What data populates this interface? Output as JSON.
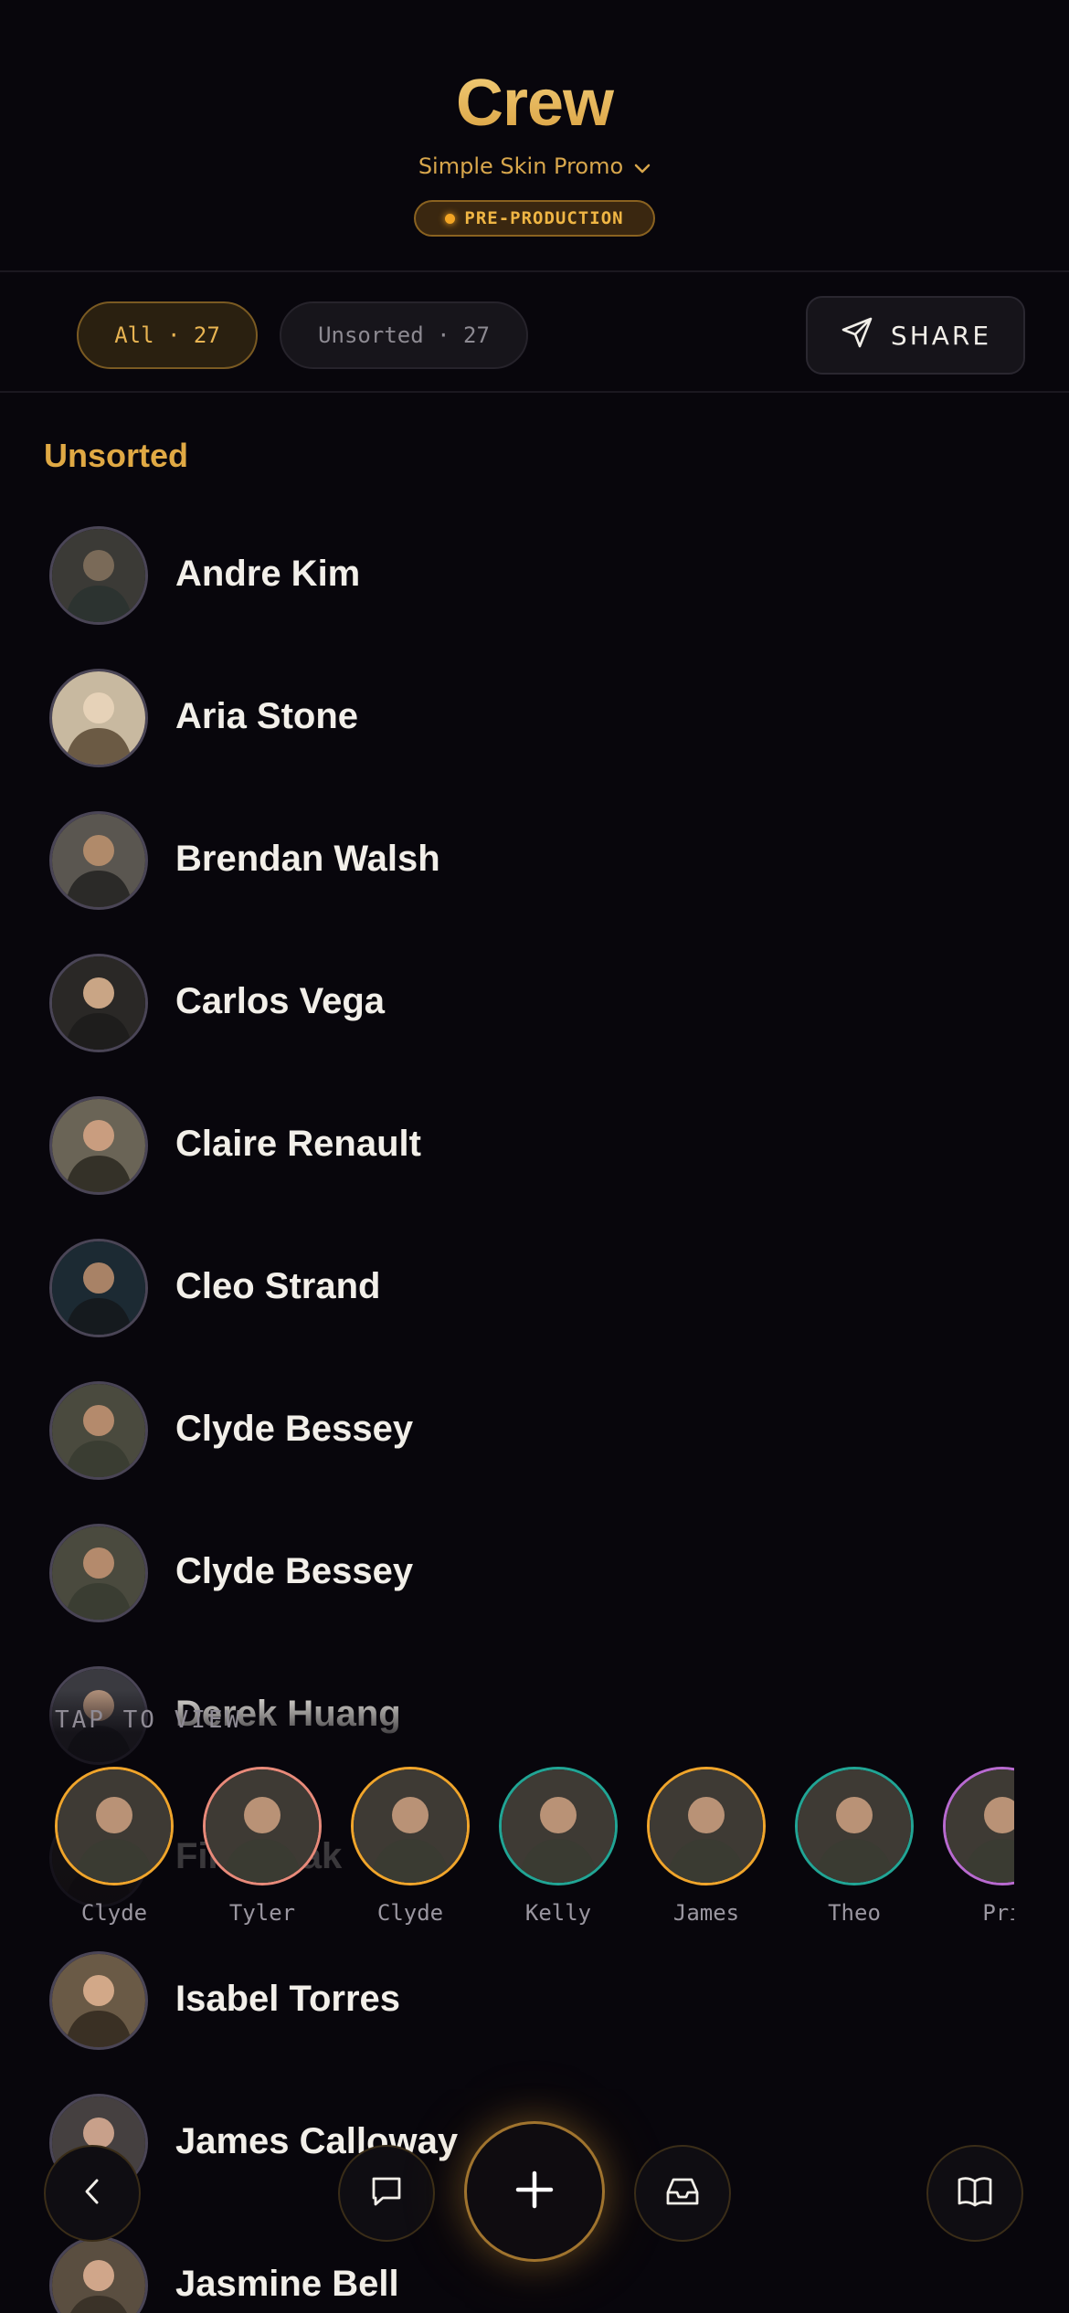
{
  "header": {
    "title": "Crew",
    "project": "Simple Skin Promo",
    "status": "PRE-PRODUCTION"
  },
  "filters": {
    "all_label": "All · 27",
    "unsorted_label": "Unsorted · 27",
    "share_label": "SHARE"
  },
  "section": {
    "label": "Unsorted"
  },
  "crew": [
    {
      "name": "Andre Kim"
    },
    {
      "name": "Aria Stone"
    },
    {
      "name": "Brendan Walsh"
    },
    {
      "name": "Carlos Vega"
    },
    {
      "name": "Claire Renault"
    },
    {
      "name": "Cleo Strand"
    },
    {
      "name": "Clyde Bessey"
    },
    {
      "name": "Clyde Bessey"
    },
    {
      "name": "Derek Huang"
    },
    {
      "name": "Fin... ...ak"
    },
    {
      "name": "Isabel Torres"
    },
    {
      "name": "James Calloway"
    },
    {
      "name": "Jasmine Bell"
    }
  ],
  "recent": {
    "hint": "TAP TO VIEW",
    "items": [
      {
        "name": "Clyde",
        "ring": "#f0a52b"
      },
      {
        "name": "Tyler",
        "ring": "#e88a7a"
      },
      {
        "name": "Clyde",
        "ring": "#f0a52b"
      },
      {
        "name": "Kelly",
        "ring": "#21a595"
      },
      {
        "name": "James",
        "ring": "#f0a52b"
      },
      {
        "name": "Theo",
        "ring": "#21a595"
      },
      {
        "name": "Pri",
        "ring": "#b86ad0"
      }
    ]
  },
  "bottom_bar": {
    "icons": [
      "chevron-left-icon",
      "chat-icon",
      "plus-icon",
      "inbox-icon",
      "book-icon"
    ]
  },
  "colors": {
    "background": "#08060c",
    "accent": "#e0a944",
    "text": "#f2efe9"
  }
}
